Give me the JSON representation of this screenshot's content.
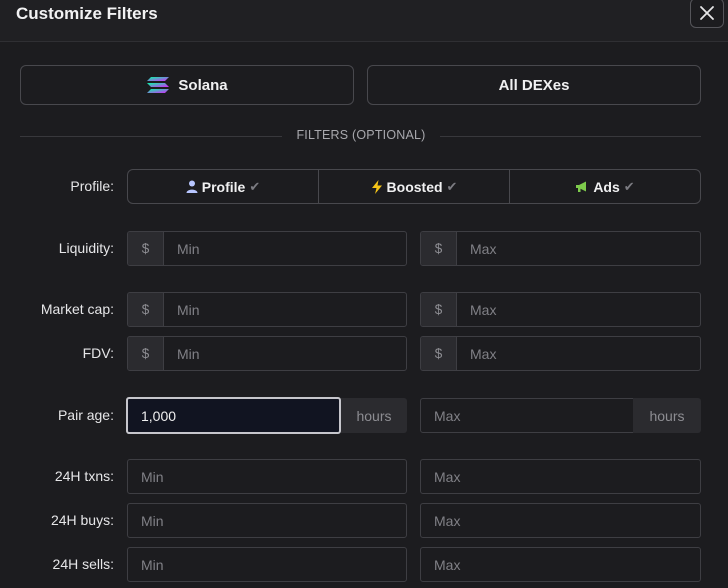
{
  "header": {
    "title": "Customize Filters"
  },
  "chain": {
    "label": "Solana"
  },
  "dex": {
    "label": "All DEXes"
  },
  "filters_divider": "FILTERS (OPTIONAL)",
  "profile": {
    "label": "Profile:",
    "options": [
      {
        "label": "Profile",
        "icon": "user-icon",
        "checked_icon": "check-icon"
      },
      {
        "label": "Boosted",
        "icon": "lightning-icon",
        "checked_icon": "check-icon"
      },
      {
        "label": "Ads",
        "icon": "megaphone-icon",
        "checked_icon": "check-icon"
      }
    ]
  },
  "liquidity": {
    "label": "Liquidity:",
    "prefix": "$",
    "min_placeholder": "Min",
    "max_placeholder": "Max"
  },
  "market_cap": {
    "label": "Market cap:",
    "prefix": "$",
    "min_placeholder": "Min",
    "max_placeholder": "Max"
  },
  "fdv": {
    "label": "FDV:",
    "prefix": "$",
    "min_placeholder": "Min",
    "max_placeholder": "Max"
  },
  "pair_age": {
    "label": "Pair age:",
    "min_value": "1,000",
    "min_placeholder": "Min",
    "max_placeholder": "Max",
    "unit": "hours"
  },
  "txns_24h": {
    "label": "24H txns:",
    "min_placeholder": "Min",
    "max_placeholder": "Max"
  },
  "buys_24h": {
    "label": "24H buys:",
    "min_placeholder": "Min",
    "max_placeholder": "Max"
  },
  "sells_24h": {
    "label": "24H sells:",
    "min_placeholder": "Min",
    "max_placeholder": "Max"
  },
  "colors": {
    "background": "#1c1c1f",
    "border": "#48484d",
    "focus_bg": "#111421",
    "boosted_icon": "#f5c518",
    "ads_icon": "#7ecb4c",
    "profile_icon": "#b8c6ff"
  }
}
